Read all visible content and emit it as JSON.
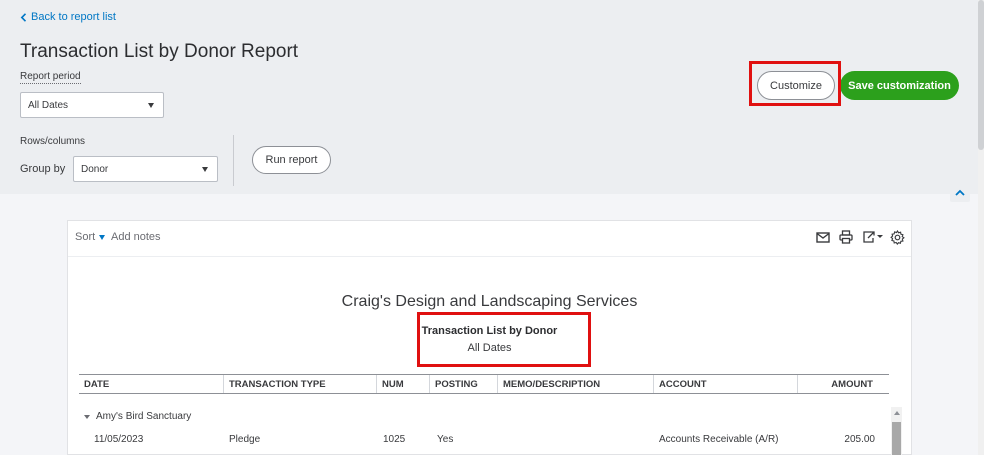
{
  "nav": {
    "back_label": "Back to report list"
  },
  "page": {
    "title": "Transaction List by Donor Report"
  },
  "settings": {
    "report_period_label": "Report period",
    "report_period_value": "All Dates",
    "rows_columns_label": "Rows/columns",
    "group_by_label": "Group by",
    "group_by_value": "Donor",
    "run_report_label": "Run report"
  },
  "actions": {
    "customize_label": "Customize",
    "save_customization_label": "Save customization"
  },
  "toolbar": {
    "sort_label": "Sort",
    "add_notes_label": "Add notes",
    "icons": [
      "mail-icon",
      "print-icon",
      "export-icon",
      "settings-gear-icon"
    ]
  },
  "report": {
    "company": "Craig's Design and Landscaping Services",
    "title": "Transaction List by Donor",
    "dates": "All Dates",
    "columns": [
      "DATE",
      "TRANSACTION TYPE",
      "NUM",
      "POSTING",
      "MEMO/DESCRIPTION",
      "ACCOUNT",
      "AMOUNT"
    ],
    "groups": [
      {
        "name": "Amy's Bird Sanctuary",
        "rows": [
          {
            "date": "11/05/2023",
            "type": "Pledge",
            "num": "1025",
            "posting": "Yes",
            "memo": "",
            "account": "Accounts Receivable (A/R)",
            "amount": "205.00"
          }
        ]
      }
    ]
  },
  "colors": {
    "accent_link": "#0077c5",
    "save_green": "#2ca01c",
    "highlight_red": "#e01010"
  }
}
